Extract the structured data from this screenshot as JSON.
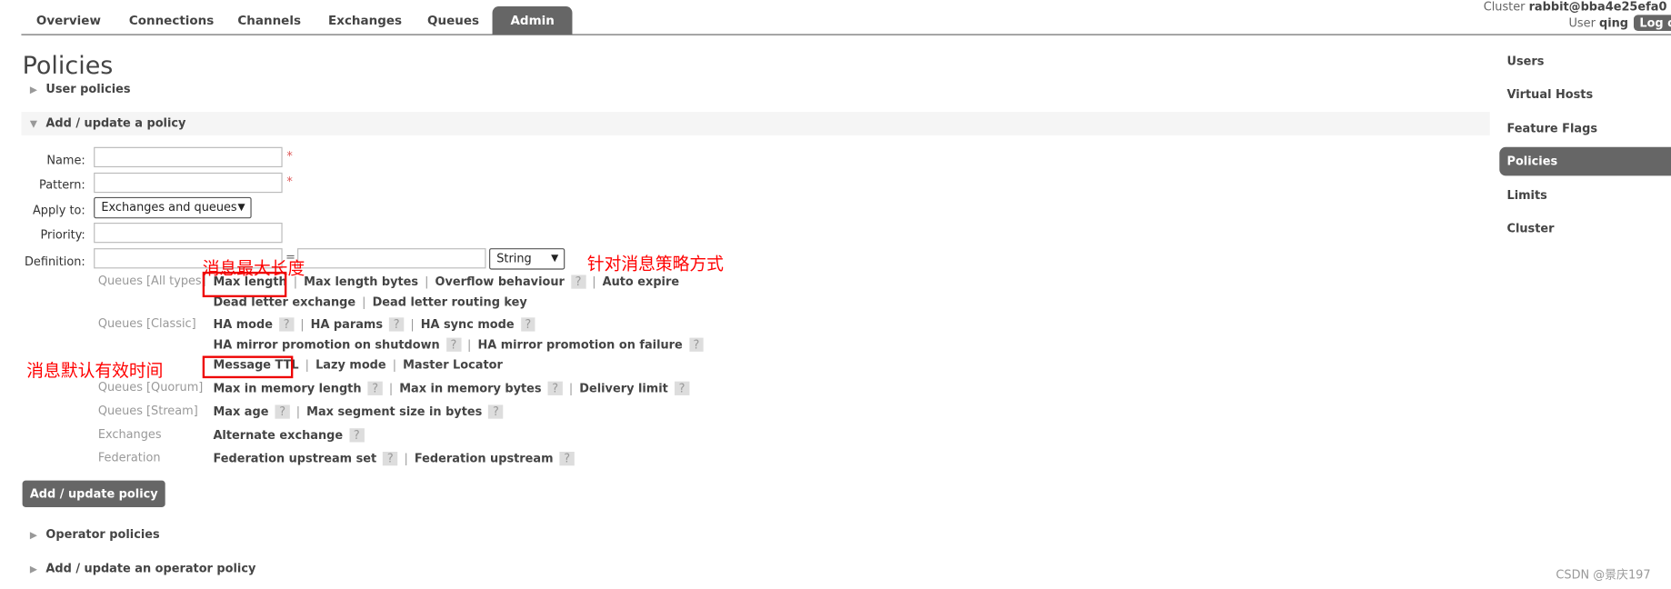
{
  "header": {
    "tabs": [
      "Overview",
      "Connections",
      "Channels",
      "Exchanges",
      "Queues",
      "Admin"
    ],
    "active_tab": "Admin",
    "cluster_label": "Cluster",
    "cluster_name": "rabbit@bba4e25efa0",
    "user_label": "User",
    "user_name": "qing",
    "logout": "Log out"
  },
  "page": {
    "title": "Policies"
  },
  "sections": {
    "user_policies": "User policies",
    "add_policy": "Add / update a policy",
    "operator_policies": "Operator policies",
    "add_operator_policy": "Add / update an operator policy"
  },
  "form": {
    "name_label": "Name:",
    "pattern_label": "Pattern:",
    "apply_label": "Apply to:",
    "apply_value": "Exchanges and queues",
    "priority_label": "Priority:",
    "definition_label": "Definition:",
    "type_value": "String",
    "required": "*",
    "eq": "=",
    "submit": "Add / update policy"
  },
  "groups": {
    "all": "Queues [All types]",
    "classic": "Queues [Classic]",
    "quorum": "Queues [Quorum]",
    "stream": "Queues [Stream]",
    "exchanges": "Exchanges",
    "federation": "Federation"
  },
  "links": {
    "max_length": "Max length",
    "max_length_bytes": "Max length bytes",
    "overflow": "Overflow behaviour",
    "auto_expire": "Auto expire",
    "dlx": "Dead letter exchange",
    "dlrk": "Dead letter routing key",
    "ha_mode": "HA mode",
    "ha_params": "HA params",
    "ha_sync": "HA sync mode",
    "ha_shutdown": "HA mirror promotion on shutdown",
    "ha_failure": "HA mirror promotion on failure",
    "ttl": "Message TTL",
    "lazy": "Lazy mode",
    "locator": "Master Locator",
    "mem_len": "Max in memory length",
    "mem_bytes": "Max in memory bytes",
    "delivery": "Delivery limit",
    "max_age": "Max age",
    "seg": "Max segment size in bytes",
    "alt": "Alternate exchange",
    "fed_set": "Federation upstream set",
    "fed_up": "Federation upstream",
    "help": "?",
    "sep": "|"
  },
  "sidebar": {
    "items": [
      "Users",
      "Virtual Hosts",
      "Feature Flags",
      "Policies",
      "Limits",
      "Cluster"
    ],
    "active": "Policies"
  },
  "annotations": {
    "max_len": "消息最大长度",
    "strategy": "针对消息策略方式",
    "ttl": "消息默认有效时间"
  },
  "watermark": "CSDN @景庆197",
  "colors": {
    "active_tab": "#666666",
    "annotation": "#ff0000"
  }
}
